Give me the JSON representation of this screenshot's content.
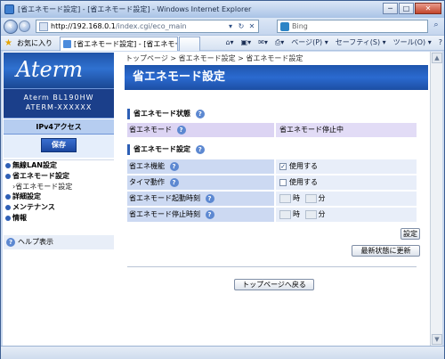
{
  "window": {
    "title": "[省エネモード設定] - [省エネモード設定] - Windows Internet Explorer",
    "buttons": {
      "minimize": "─",
      "maximize": "□",
      "close": "✕"
    }
  },
  "address_bar": {
    "url_host": "http://192.168.0.1",
    "url_path": "/index.cgi/eco_main",
    "search_placeholder": "Bing"
  },
  "favorites_bar": {
    "favorites_label": "お気に入り",
    "tabs": [
      {
        "label": "[省エネモード設定] - [省エネモード..."
      },
      {
        "label": ""
      }
    ],
    "commands": [
      "ページ(P) ▾",
      "セーフティ(S) ▾",
      "ツール(O) ▾",
      "?"
    ]
  },
  "sidebar": {
    "logo": "Aterm",
    "model_line1": "Aterm BL190HW",
    "model_line2": "ATERM-XXXXXX",
    "mode": "IPv4アクセス",
    "save_label": "保存",
    "menu": [
      {
        "label": "無線LAN設定"
      },
      {
        "label": "省エネモード設定",
        "sub": "›省エネモード設定"
      },
      {
        "label": "詳細設定"
      },
      {
        "label": "メンテナンス"
      },
      {
        "label": "情報"
      }
    ],
    "help_label": "ヘルプ表示"
  },
  "main": {
    "breadcrumb": "トップページ > 省エネモード設定 > 省エネモード設定",
    "page_title": "省エネモード設定",
    "status_section": {
      "title": "省エネモード状態",
      "rows": [
        {
          "label": "省エネモード",
          "value": "省エネモード停止中"
        }
      ]
    },
    "settings_section": {
      "title": "省エネモード設定",
      "rows": [
        {
          "label": "省エネ機能",
          "value": "使用する",
          "checked": true
        },
        {
          "label": "タイマ動作",
          "value": "使用する",
          "checked": false
        },
        {
          "label": "省エネモード起動時刻",
          "hour_unit": "時",
          "minute_unit": "分"
        },
        {
          "label": "省エネモード停止時刻",
          "hour_unit": "時",
          "minute_unit": "分"
        }
      ]
    },
    "set_button": "設定",
    "refresh_button": "最新状態に更新",
    "top_button": "トップページへ戻る"
  },
  "colors": {
    "header_blue": "#2b6ad0",
    "label_cell": "#ccd9f2",
    "value_cell": "#e8eef9"
  }
}
